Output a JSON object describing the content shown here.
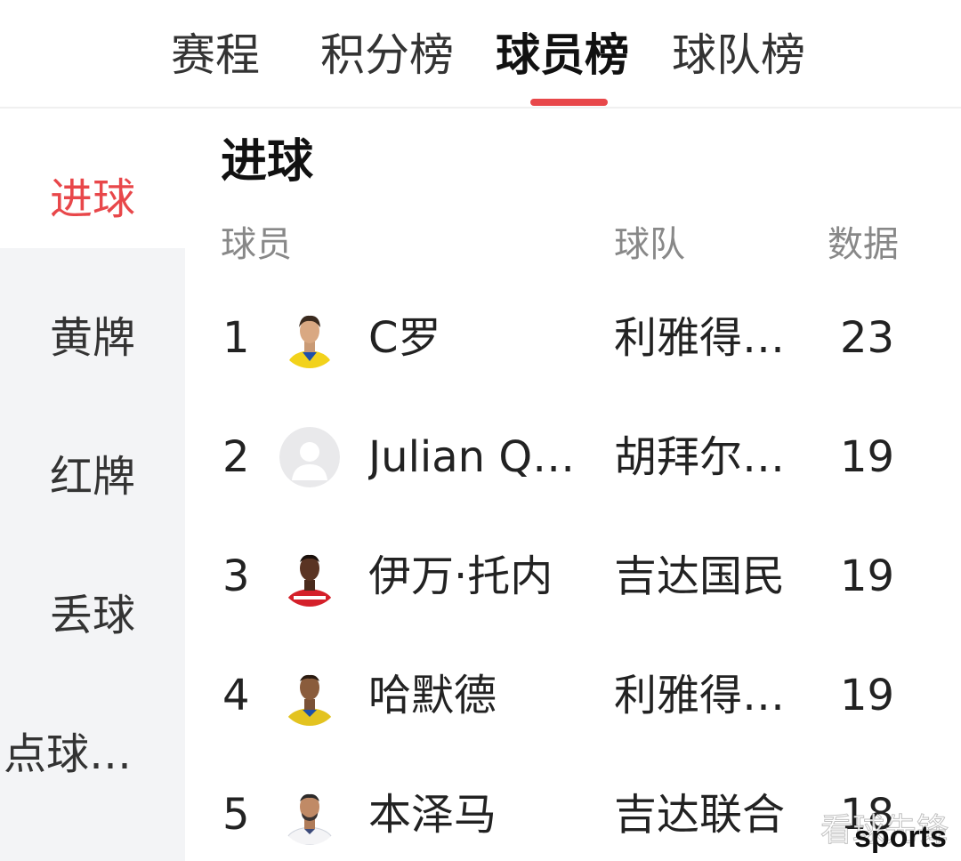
{
  "tabs": [
    {
      "label": "赛程"
    },
    {
      "label": "积分榜"
    },
    {
      "label": "球员榜"
    },
    {
      "label": "球队榜"
    }
  ],
  "active_tab": "球员榜",
  "sidebar": {
    "items": [
      {
        "label": "进球"
      },
      {
        "label": "黄牌"
      },
      {
        "label": "红牌"
      },
      {
        "label": "丢球"
      },
      {
        "label": "点球…"
      }
    ],
    "active_item": "进球"
  },
  "section": {
    "title": "进球",
    "columns": {
      "player": "球员",
      "team": "球队",
      "value": "数据"
    }
  },
  "rows": [
    {
      "rank": "1",
      "player": "C罗",
      "team": "利雅得…",
      "value": "23",
      "avatar": "player-photo-yellow-kit"
    },
    {
      "rank": "2",
      "player": "Julian Q…",
      "team": "胡拜尔…",
      "value": "19",
      "avatar": "default-avatar"
    },
    {
      "rank": "3",
      "player": "伊万·托内",
      "team": "吉达国民",
      "value": "19",
      "avatar": "player-photo-red-white-kit"
    },
    {
      "rank": "4",
      "player": "哈默德",
      "team": "利雅得…",
      "value": "19",
      "avatar": "player-photo-yellow-kit"
    },
    {
      "rank": "5",
      "player": "本泽马",
      "team": "吉达联合",
      "value": "18",
      "avatar": "player-photo-white-kit"
    }
  ],
  "watermark": {
    "line1": "看球先锋",
    "line2": "sports"
  },
  "colors": {
    "accent": "#e8474a",
    "sidebar_bg": "#f3f4f6",
    "header_text": "#888888"
  }
}
